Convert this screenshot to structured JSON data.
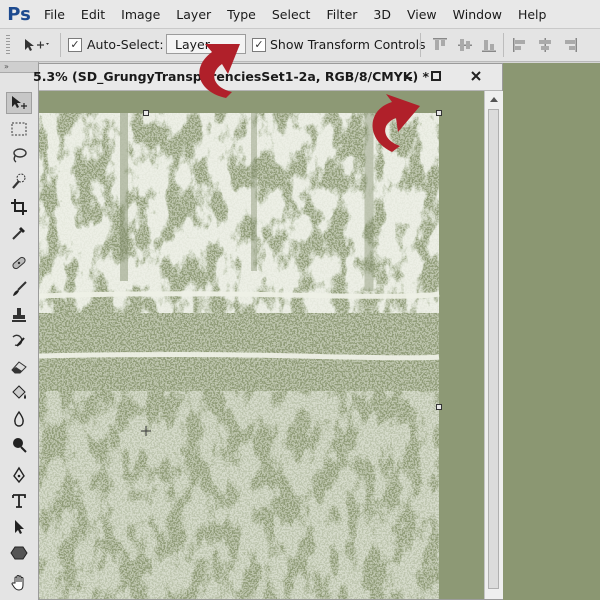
{
  "app": {
    "logo": "Ps"
  },
  "menu": [
    "File",
    "Edit",
    "Image",
    "Layer",
    "Type",
    "Select",
    "Filter",
    "3D",
    "View",
    "Window",
    "Help"
  ],
  "options": {
    "auto_select_label": "Auto-Select:",
    "auto_select_checked": true,
    "auto_select_value": "Layer",
    "show_transform_label": "Show Transform Controls",
    "show_transform_checked": true
  },
  "tools": [
    "move-tool",
    "marquee-tool",
    "lasso-tool",
    "quick-selection-tool",
    "crop-tool",
    "eyedropper-tool",
    "spot-healing-tool",
    "brush-tool",
    "clone-stamp-tool",
    "history-brush-tool",
    "eraser-tool",
    "paint-bucket-tool",
    "blur-tool",
    "dodge-tool",
    "pen-tool",
    "type-tool",
    "path-selection-tool",
    "shape-tool",
    "hand-tool"
  ],
  "document": {
    "title": "5.3% (SD_GrungyTransparenciesSet1-2a, RGB/8/CMYK) *",
    "minimize": "–",
    "maximize": "□",
    "close": "✕"
  },
  "colors": {
    "canvas_bg": "#8d9975",
    "texture_light": "#e6eadc",
    "arrow_red": "#b0202a"
  }
}
